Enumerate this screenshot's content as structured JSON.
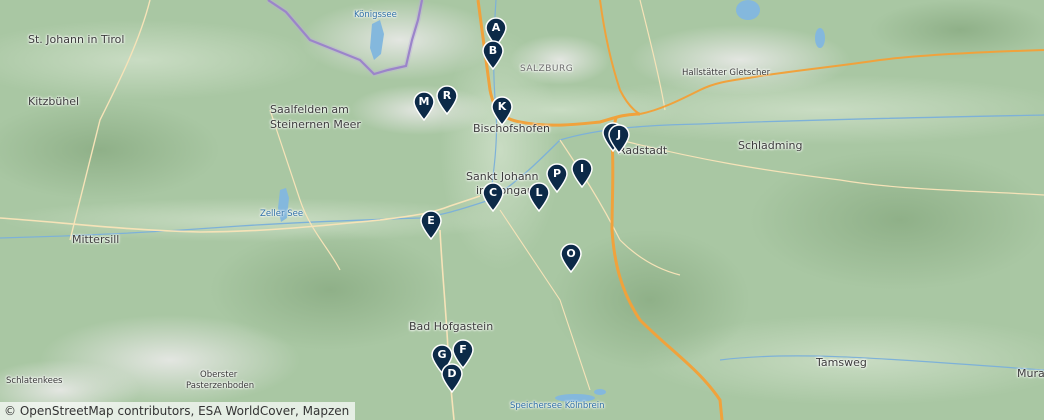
{
  "places": {
    "st_johann_tirol": "St. Johann in Tirol",
    "kitzbuehel": "Kitzbühel",
    "saalfelden_1": "Saalfelden am",
    "saalfelden_2": "Steinernen Meer",
    "bischofshofen": "Bischofshofen",
    "sankt_johann_1": "Sankt Johann",
    "sankt_johann_2": "im Pongau",
    "radstadt": "Radstadt",
    "schladming": "Schladming",
    "mittersill": "Mittersill",
    "bad_hofgastein": "Bad Hofgastein",
    "tamsweg": "Tamsweg",
    "mura": "Mura"
  },
  "small_labels": {
    "koenigssee": "Königssee",
    "zeller_see": "Zeller See",
    "hallstaetter": "Hallstätter Gletscher",
    "salzburg_region": "SALZBURG",
    "oberster_1": "Oberster",
    "oberster_2": "Pasterzenboden",
    "schlatenkees": "Schlatenkees",
    "speichersee": "Speichersee Kölnbrein"
  },
  "markers": [
    {
      "letter": "A"
    },
    {
      "letter": "B"
    },
    {
      "letter": "K"
    },
    {
      "letter": "M"
    },
    {
      "letter": "R"
    },
    {
      "letter": "J"
    },
    {
      "letter": "I"
    },
    {
      "letter": "P"
    },
    {
      "letter": "L"
    },
    {
      "letter": "C"
    },
    {
      "letter": "E"
    },
    {
      "letter": "O"
    },
    {
      "letter": "F"
    },
    {
      "letter": "G"
    },
    {
      "letter": "D"
    }
  ],
  "attribution": {
    "symbol": "©",
    "text": " OpenStreetMap contributors, ESA WorldCover, Mapzen"
  },
  "colors": {
    "marker_fill": "#0c2a48",
    "road": "#f0a23c",
    "border": "#8a70c0",
    "lake": "#84b8dd",
    "terrain": "#a9c7a3"
  }
}
